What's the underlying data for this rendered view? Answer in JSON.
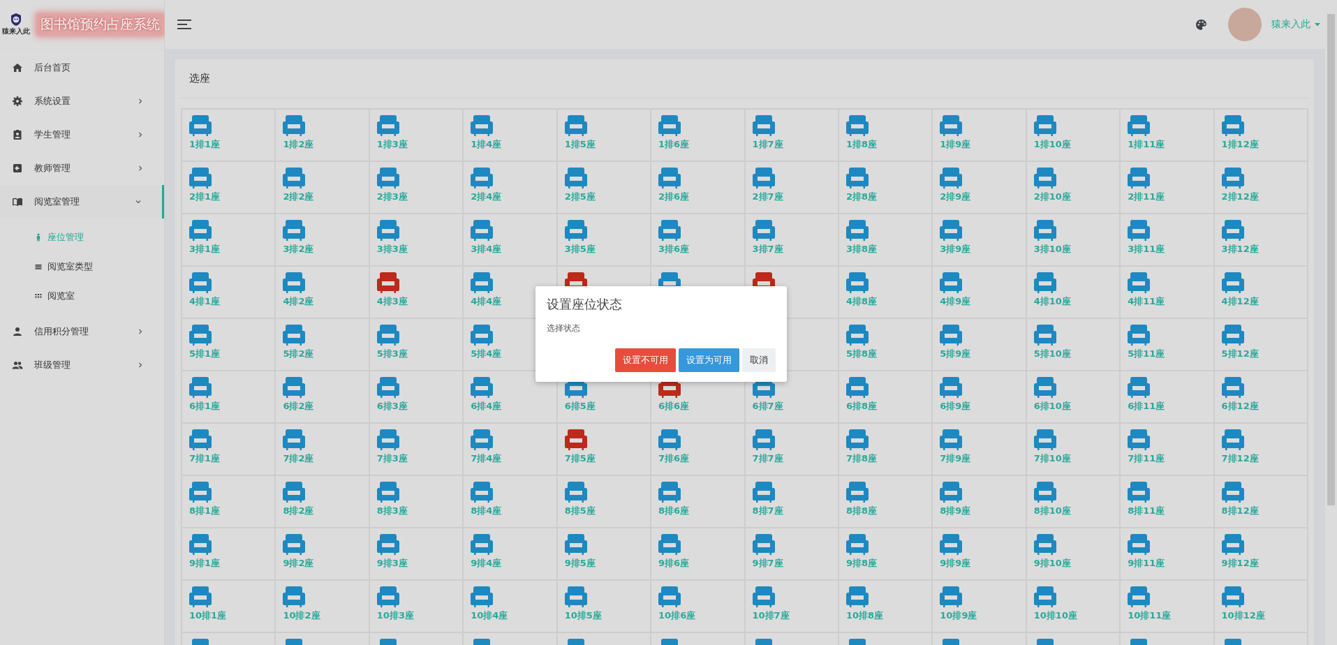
{
  "header": {
    "logo_text": "猿来入此",
    "title": "图书馆预约占座系统",
    "user_name": "猿来入此"
  },
  "sidebar": {
    "items": [
      {
        "label": "后台首页",
        "kind": "link",
        "expanded": false
      },
      {
        "label": "系统设置",
        "kind": "menu",
        "expanded": false
      },
      {
        "label": "学生管理",
        "kind": "menu",
        "expanded": false
      },
      {
        "label": "教师管理",
        "kind": "menu",
        "expanded": false
      },
      {
        "label": "阅览室管理",
        "kind": "menu",
        "expanded": true,
        "children": [
          {
            "label": "座位管理",
            "selected": true
          },
          {
            "label": "阅览室类型",
            "selected": false
          },
          {
            "label": "阅览室",
            "selected": false
          }
        ]
      },
      {
        "label": "信用积分管理",
        "kind": "menu",
        "expanded": false
      },
      {
        "label": "班级管理",
        "kind": "menu",
        "expanded": false
      }
    ]
  },
  "panel": {
    "title": "选座",
    "rows": [
      {
        "seats": [
          {
            "label": "1排1座",
            "available": true
          },
          {
            "label": "1排2座",
            "available": true
          },
          {
            "label": "1排3座",
            "available": true
          },
          {
            "label": "1排4座",
            "available": true
          },
          {
            "label": "1排5座",
            "available": true
          },
          {
            "label": "1排6座",
            "available": true
          },
          {
            "label": "1排7座",
            "available": true
          },
          {
            "label": "1排8座",
            "available": true
          },
          {
            "label": "1排9座",
            "available": true
          },
          {
            "label": "1排10座",
            "available": true
          },
          {
            "label": "1排11座",
            "available": true
          },
          {
            "label": "1排12座",
            "available": true
          }
        ]
      },
      {
        "seats": [
          {
            "label": "2排1座",
            "available": true
          },
          {
            "label": "2排2座",
            "available": true
          },
          {
            "label": "2排3座",
            "available": true
          },
          {
            "label": "2排4座",
            "available": true
          },
          {
            "label": "2排5座",
            "available": true
          },
          {
            "label": "2排6座",
            "available": true
          },
          {
            "label": "2排7座",
            "available": true
          },
          {
            "label": "2排8座",
            "available": true
          },
          {
            "label": "2排9座",
            "available": true
          },
          {
            "label": "2排10座",
            "available": true
          },
          {
            "label": "2排11座",
            "available": true
          },
          {
            "label": "2排12座",
            "available": true
          }
        ]
      },
      {
        "seats": [
          {
            "label": "3排1座",
            "available": true
          },
          {
            "label": "3排2座",
            "available": true
          },
          {
            "label": "3排3座",
            "available": true
          },
          {
            "label": "3排4座",
            "available": true
          },
          {
            "label": "3排5座",
            "available": true
          },
          {
            "label": "3排6座",
            "available": true
          },
          {
            "label": "3排7座",
            "available": true
          },
          {
            "label": "3排8座",
            "available": true
          },
          {
            "label": "3排9座",
            "available": true
          },
          {
            "label": "3排10座",
            "available": true
          },
          {
            "label": "3排11座",
            "available": true
          },
          {
            "label": "3排12座",
            "available": true
          }
        ]
      },
      {
        "seats": [
          {
            "label": "4排1座",
            "available": true
          },
          {
            "label": "4排2座",
            "available": true
          },
          {
            "label": "4排3座",
            "available": false
          },
          {
            "label": "4排4座",
            "available": true
          },
          {
            "available": false
          },
          {
            "available": true
          },
          {
            "available": false
          },
          {
            "label": "4排8座",
            "available": true
          },
          {
            "label": "4排9座",
            "available": true
          },
          {
            "label": "4排10座",
            "available": true
          },
          {
            "label": "4排11座",
            "available": true
          },
          {
            "label": "4排12座",
            "available": true
          }
        ]
      },
      {
        "seats": [
          {
            "label": "5排1座",
            "available": true
          },
          {
            "label": "5排2座",
            "available": true
          },
          {
            "label": "5排3座",
            "available": true
          },
          {
            "label": "5排4座",
            "available": true
          }
        ],
        "seats_after_gap": [
          {
            "label": "5排8座",
            "available": true
          },
          {
            "label": "5排9座",
            "available": true
          },
          {
            "label": "5排10座",
            "available": true
          },
          {
            "label": "5排11座",
            "available": true
          },
          {
            "label": "5排12座",
            "available": true
          }
        ]
      },
      {
        "seats": [
          {
            "label": "6排1座",
            "available": true
          },
          {
            "label": "6排2座",
            "available": true
          },
          {
            "label": "6排3座",
            "available": true
          },
          {
            "label": "6排4座",
            "available": true
          },
          {
            "label": "6排5座",
            "available": true
          },
          {
            "label": "6排6座",
            "available": false
          },
          {
            "label": "6排7座",
            "available": true
          },
          {
            "label": "6排8座",
            "available": true
          },
          {
            "label": "6排9座",
            "available": true
          },
          {
            "label": "6排10座",
            "available": true
          },
          {
            "label": "6排11座",
            "available": true
          },
          {
            "label": "6排12座",
            "available": true
          }
        ]
      },
      {
        "seats": [
          {
            "label": "7排1座",
            "available": true
          },
          {
            "label": "7排2座",
            "available": true
          },
          {
            "label": "7排3座",
            "available": true
          },
          {
            "label": "7排4座",
            "available": true
          },
          {
            "label": "7排5座",
            "available": false
          },
          {
            "label": "7排6座",
            "available": true
          },
          {
            "label": "7排7座",
            "available": true
          },
          {
            "label": "7排8座",
            "available": true
          },
          {
            "label": "7排9座",
            "available": true
          },
          {
            "label": "7排10座",
            "available": true
          },
          {
            "label": "7排11座",
            "available": true
          },
          {
            "label": "7排12座",
            "available": true
          }
        ]
      },
      {
        "seats": [
          {
            "label": "8排1座",
            "available": true
          },
          {
            "label": "8排2座",
            "available": true
          },
          {
            "label": "8排3座",
            "available": true
          },
          {
            "label": "8排4座",
            "available": true
          },
          {
            "label": "8排5座",
            "available": true
          },
          {
            "label": "8排6座",
            "available": true
          },
          {
            "label": "8排7座",
            "available": true
          },
          {
            "label": "8排8座",
            "available": true
          },
          {
            "label": "8排9座",
            "available": true
          },
          {
            "label": "8排10座",
            "available": true
          },
          {
            "label": "8排11座",
            "available": true
          },
          {
            "label": "8排12座",
            "available": true
          }
        ]
      },
      {
        "seats": [
          {
            "label": "9排1座",
            "available": true
          },
          {
            "label": "9排2座",
            "available": true
          },
          {
            "label": "9排3座",
            "available": true
          },
          {
            "label": "9排4座",
            "available": true
          },
          {
            "label": "9排5座",
            "available": true
          },
          {
            "label": "9排6座",
            "available": true
          },
          {
            "label": "9排7座",
            "available": true
          },
          {
            "label": "9排8座",
            "available": true
          },
          {
            "label": "9排9座",
            "available": true
          },
          {
            "label": "9排10座",
            "available": true
          },
          {
            "label": "9排11座",
            "available": true
          },
          {
            "label": "9排12座",
            "available": true
          }
        ]
      },
      {
        "seats": [
          {
            "label": "10排1座",
            "available": true
          },
          {
            "label": "10排2座",
            "available": true
          },
          {
            "label": "10排3座",
            "available": true
          },
          {
            "label": "10排4座",
            "available": true
          },
          {
            "label": "10排5座",
            "available": true
          },
          {
            "label": "10排6座",
            "available": true
          },
          {
            "label": "10排7座",
            "available": true
          },
          {
            "label": "10排8座",
            "available": true
          },
          {
            "label": "10排9座",
            "available": true
          },
          {
            "label": "10排10座",
            "available": true
          },
          {
            "label": "10排11座",
            "available": true
          },
          {
            "label": "10排12座",
            "available": true
          }
        ]
      },
      {
        "seats": [
          {
            "available": true
          },
          {
            "available": true
          },
          {
            "available": true
          },
          {
            "available": true
          },
          {
            "available": true
          },
          {
            "available": true
          },
          {
            "available": true
          },
          {
            "available": true
          },
          {
            "available": true
          },
          {
            "available": true
          },
          {
            "available": true
          },
          {
            "available": true
          }
        ]
      }
    ]
  },
  "dialog": {
    "title": "设置座位状态",
    "message": "选择状态",
    "buttons": [
      {
        "label": "设置不可用",
        "kind": "danger"
      },
      {
        "label": "设置为可用",
        "kind": "primary"
      },
      {
        "label": "取消",
        "kind": "default"
      }
    ]
  }
}
